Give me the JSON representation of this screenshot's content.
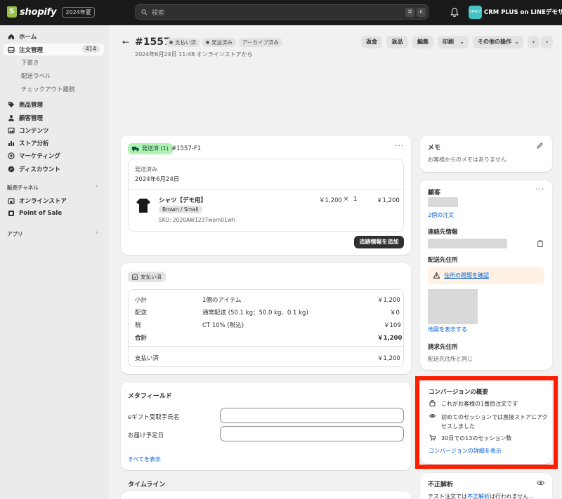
{
  "topbar": {
    "brand": "shopify",
    "edition": "2024年夏",
    "search_placeholder": "検索",
    "shortcut_keys": [
      "⌘",
      "K"
    ],
    "store_avatar_text": "CRMプラス",
    "store_name": "CRM PLUS on LINEデモサ..."
  },
  "sidebar": {
    "items": [
      {
        "label": "ホーム",
        "icon": "home-icon"
      },
      {
        "label": "注文管理",
        "icon": "inbox-icon",
        "badge": "414",
        "active": true
      },
      {
        "label": "商品管理",
        "icon": "tag-icon"
      },
      {
        "label": "顧客管理",
        "icon": "person-icon"
      },
      {
        "label": "コンテンツ",
        "icon": "image-icon"
      },
      {
        "label": "ストア分析",
        "icon": "bar-chart-icon"
      },
      {
        "label": "マーケティング",
        "icon": "target-icon"
      },
      {
        "label": "ディスカウント",
        "icon": "discount-icon"
      }
    ],
    "sub_items": [
      "下書き",
      "配送ラベル",
      "チェックアウト離脱"
    ],
    "sales_channels_heading": "販売チャネル",
    "channels": [
      {
        "label": "オンラインストア",
        "icon": "store-icon"
      },
      {
        "label": "Point of Sale",
        "icon": "pos-icon"
      }
    ],
    "apps_heading": "アプリ"
  },
  "header": {
    "title": "#1557",
    "status_paid": "支払い済",
    "status_fulfilled": "発送済み",
    "status_archived": "アーカイブ済み",
    "subtitle": "2024年6月24日 11:48 オンラインストアから",
    "buttons": {
      "refund": "返金",
      "return": "返品",
      "edit": "編集",
      "print": "印刷",
      "more": "その他の操作"
    }
  },
  "fulfillment": {
    "badge": "発送済 (1)",
    "id": "#1557-F1",
    "status_label": "発送済み",
    "date": "2024年6月24日",
    "item_name": "シャツ【デモ用】",
    "variant": "Brown / Small",
    "sku": "SKU: 2020AW1237wom01wh",
    "price": "￥1,200",
    "qty": "×",
    "qty_num": "1",
    "total": "￥1,200",
    "add_tracking": "追跡情報を追加"
  },
  "payment": {
    "badge": "支払い済",
    "rows": [
      {
        "label": "小計",
        "detail": "1個のアイテム",
        "amount": "￥1,200"
      },
      {
        "label": "配送",
        "detail": "通常配送 (50.1 kg：50.0 kg、0.1 kg)",
        "amount": "￥0"
      },
      {
        "label": "税",
        "detail": "CT 10% (税込)",
        "amount": "￥109"
      },
      {
        "label": "合計",
        "detail": "",
        "amount": "￥1,200"
      }
    ],
    "paid_label": "支払い済",
    "paid_amount": "￥1,200"
  },
  "metafields": {
    "title": "メタフィールド",
    "fields": [
      "eギフト受取手氏名",
      "お届け予定日"
    ],
    "show_all": "すべてを表示"
  },
  "timeline": {
    "title": "タイムライン"
  },
  "notes": {
    "title": "メモ",
    "empty": "お客様からのメモはありません"
  },
  "customer": {
    "title": "顧客",
    "orders_link": "2個の注文",
    "contact_heading": "連絡先情報",
    "shipping_heading": "配送先住所",
    "address_warning": "住所の問題を確認",
    "map_link": "地図を表示する",
    "billing_heading": "請求先住所",
    "billing_same": "配送先住所と同じ"
  },
  "conversion": {
    "title": "コンバージョンの概要",
    "first_order": "これがお客様の1番目注文です",
    "first_session": "初めてのセッションでは直接ストアにアクセスしました",
    "sessions": "30日での13のセッション数",
    "details_link": "コンバージョンの詳細を表示"
  },
  "fraud": {
    "title": "不正解析",
    "text": "テスト注文では",
    "link": "不正解析",
    "text_after": "は行われません..."
  }
}
